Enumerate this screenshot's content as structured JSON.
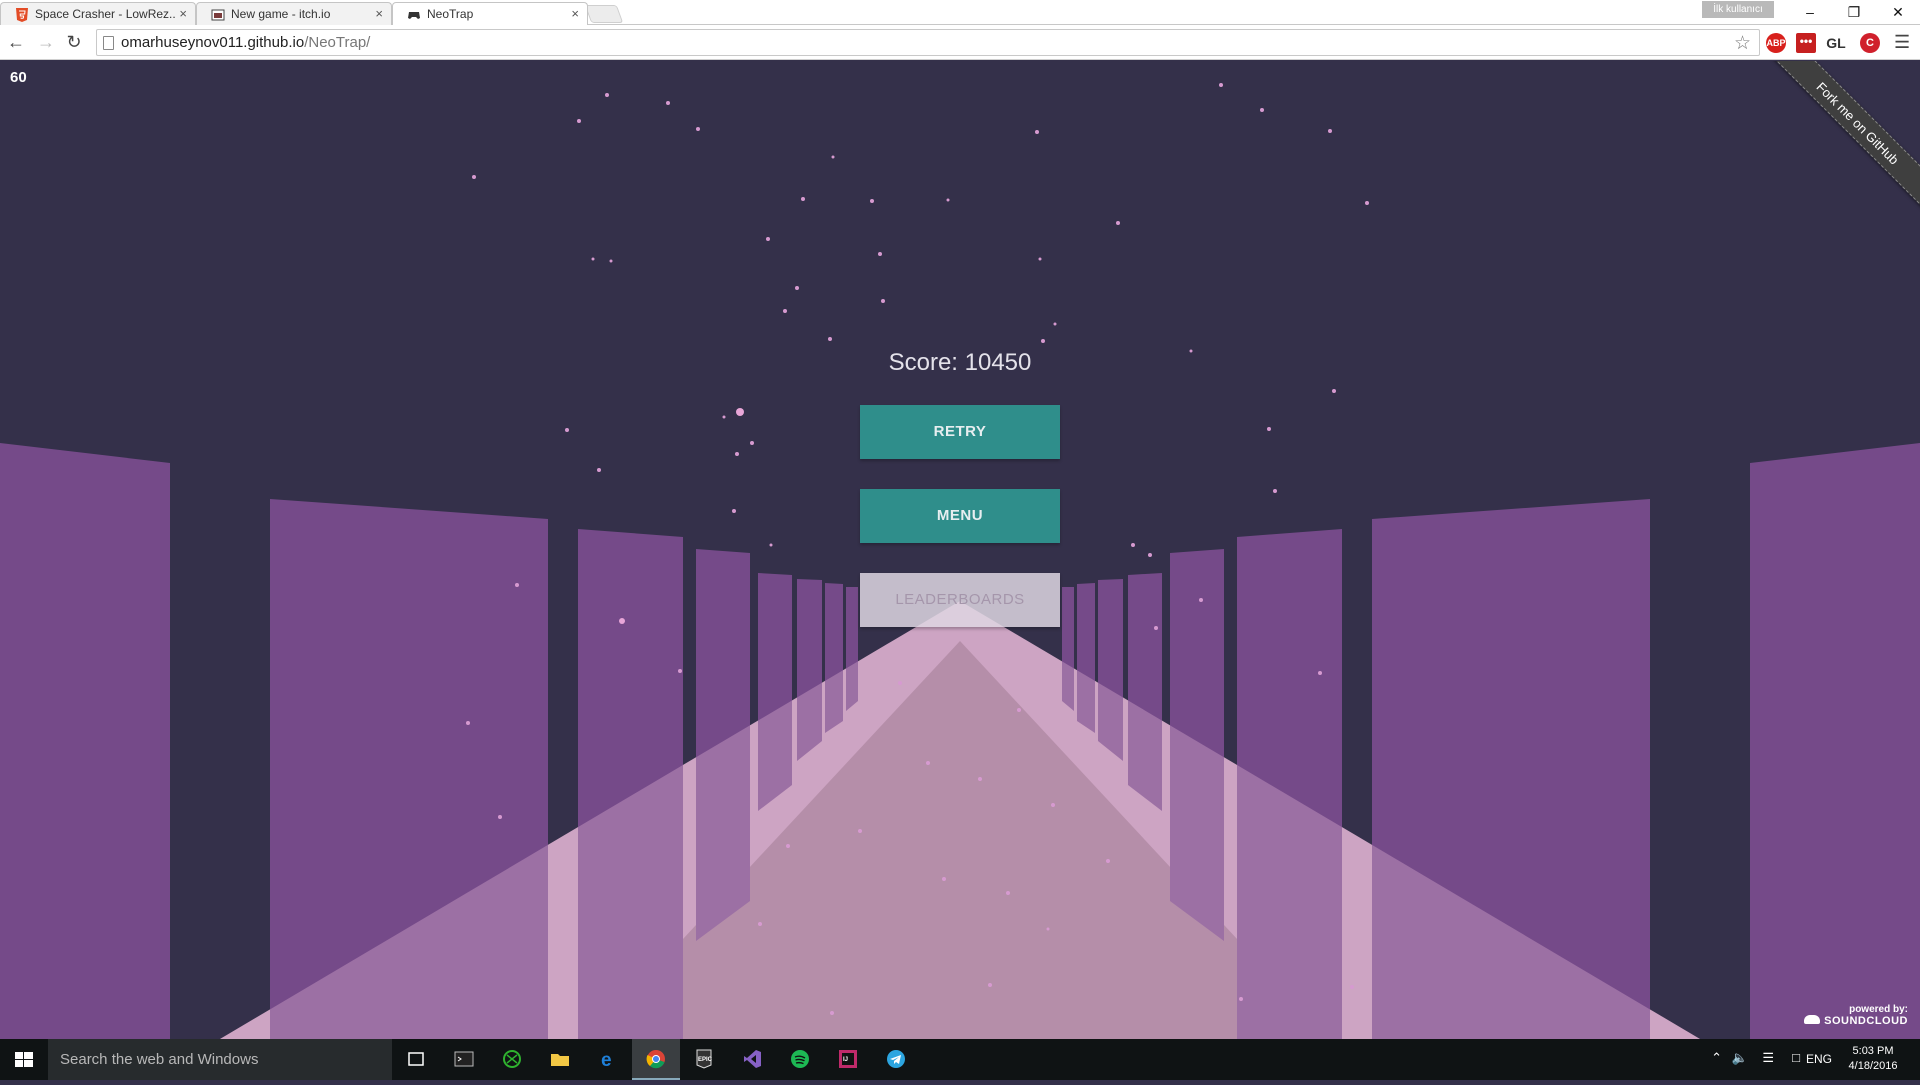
{
  "browser": {
    "tabs": [
      {
        "title": "Space Crasher - LowRez...",
        "icon": "html5-icon",
        "active": false
      },
      {
        "title": "New game - itch.io",
        "icon": "itchio-icon",
        "active": false
      },
      {
        "title": "NeoTrap",
        "icon": "gamepad-icon",
        "active": true
      }
    ],
    "window_user": "İlk kullanıcı",
    "url_host": "omarhuseynov011.github.io",
    "url_path": "/NeoTrap/",
    "extensions": [
      "ABP",
      "•••",
      "GL",
      "C"
    ]
  },
  "game": {
    "fps": "60",
    "score_text": "Score: 10450",
    "buttons": {
      "retry": "RETRY",
      "menu": "MENU",
      "leaderboards": "LEADERBOARDS"
    },
    "fork_ribbon": "Fork me on GitHub",
    "powered_by": "powered by:",
    "powered_brand": "SOUNDCLOUD",
    "colors": {
      "background": "#34304a",
      "wall": "#754a89",
      "floor_light": "#c9a0bf",
      "button": "#2f8e8b"
    }
  },
  "taskbar": {
    "search_placeholder": "Search the web and Windows",
    "apps": [
      "task-view-icon",
      "terminal-icon",
      "xbox-icon",
      "file-explorer-icon",
      "edge-icon",
      "chrome-icon",
      "epic-games-icon",
      "visual-studio-icon",
      "spotify-icon",
      "intellij-icon",
      "telegram-icon"
    ],
    "language": "ENG",
    "time": "5:03 PM",
    "date": "4/18/2016"
  }
}
